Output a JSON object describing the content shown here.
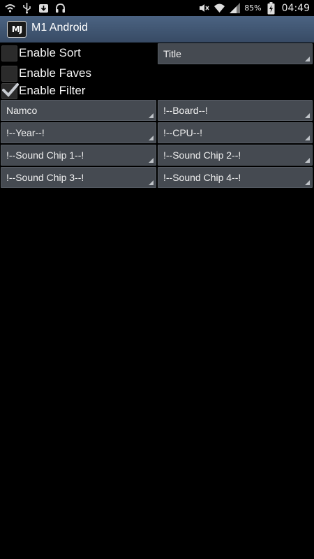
{
  "status_bar": {
    "icons_left": [
      "wifi-signal-icon",
      "usb-icon",
      "download-icon",
      "headset-icon"
    ],
    "icons_right": [
      "mute-icon",
      "wifi-icon",
      "signal-icon"
    ],
    "battery": "85%",
    "time": "04:49"
  },
  "app": {
    "logo": "MJ",
    "title": "M1 Android"
  },
  "options": {
    "enable_sort": {
      "label": "Enable Sort",
      "checked": false
    },
    "enable_faves": {
      "label": "Enable Faves",
      "checked": false
    },
    "enable_filter": {
      "label": "Enable Filter",
      "checked": true
    },
    "sort_by": "Title"
  },
  "filters": {
    "manufacturer": "Namco",
    "board": "!--Board--!",
    "year": "!--Year--!",
    "cpu": "!--CPU--!",
    "sound_chip_1": "!--Sound Chip 1--!",
    "sound_chip_2": "!--Sound Chip 2--!",
    "sound_chip_3": "!--Sound Chip 3--!",
    "sound_chip_4": "!--Sound Chip 4--!"
  },
  "colors": {
    "action_bar": "#3f5470",
    "spinner_bg": "#454a51",
    "background": "#000000"
  }
}
